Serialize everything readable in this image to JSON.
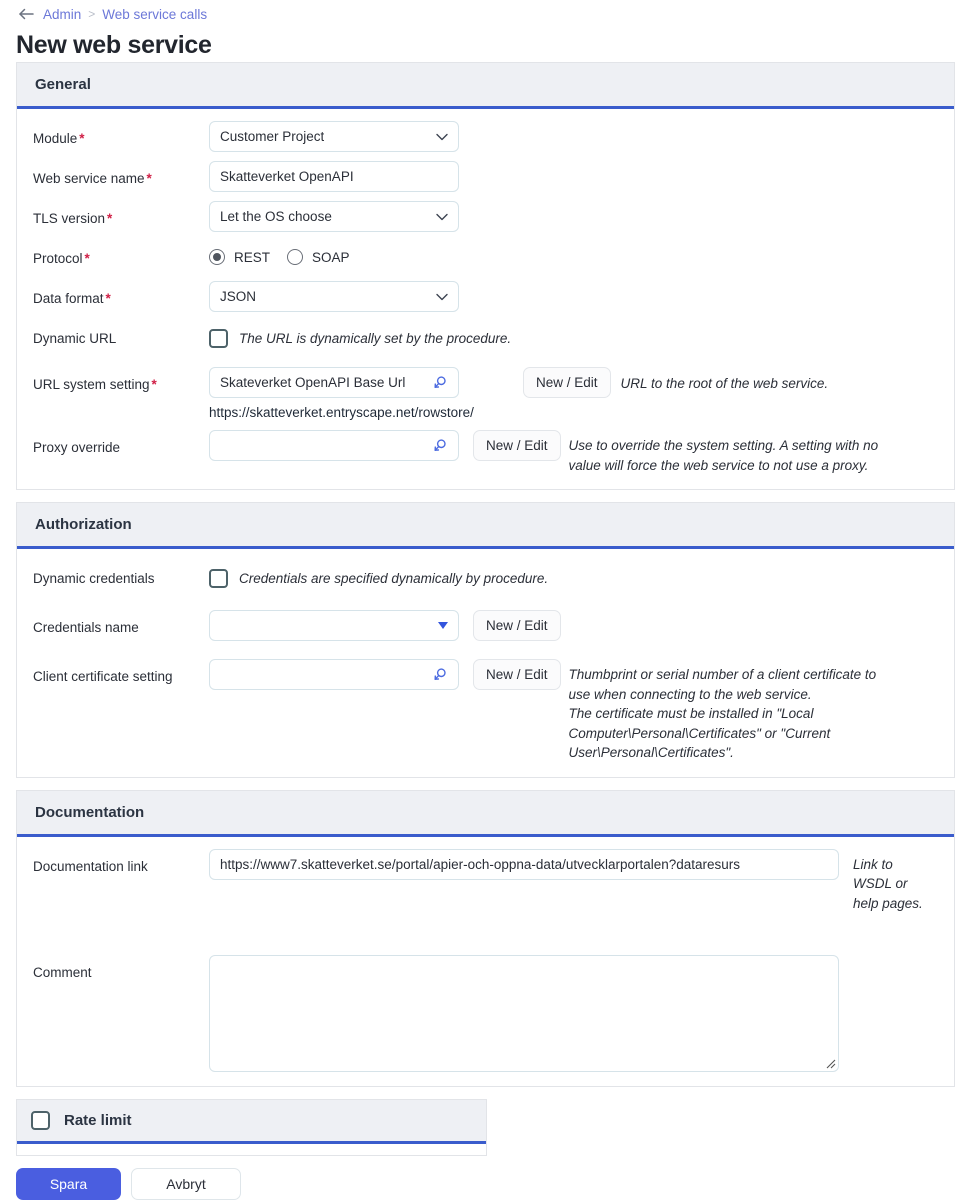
{
  "breadcrumb": {
    "back_icon": "back-arrow-icon",
    "items": [
      "Admin",
      "Web service calls"
    ],
    "separator": ">"
  },
  "page_title": "New web service",
  "colors": {
    "accent": "#3a5ccc",
    "primary_button": "#4a5ee0",
    "link": "#6c78d8",
    "required_marker": "#d01f46",
    "section_header_bg": "#eef0f4"
  },
  "sections": {
    "general": {
      "title": "General",
      "module": {
        "label": "Module",
        "required": "*",
        "value": "Customer Project"
      },
      "web_service_name": {
        "label": "Web service name",
        "required": "*",
        "value": "Skatteverket OpenAPI"
      },
      "tls_version": {
        "label": "TLS version",
        "required": "*",
        "value": "Let the OS choose"
      },
      "protocol": {
        "label": "Protocol",
        "required": "*",
        "options": [
          "REST",
          "SOAP"
        ],
        "selected": "REST"
      },
      "data_format": {
        "label": "Data format",
        "required": "*",
        "value": "JSON"
      },
      "dynamic_url": {
        "label": "Dynamic URL",
        "checkbox_label": "The URL is dynamically set by the procedure.",
        "checked": false
      },
      "url_system_setting": {
        "label": "URL system setting",
        "required": "*",
        "value": "Skateverket OpenAPI Base Url",
        "button": "New / Edit",
        "helper": "URL to the root of the web service.",
        "resolved_url": "https://skatteverket.entryscape.net/rowstore/"
      },
      "proxy_override": {
        "label": "Proxy override",
        "value": "",
        "button": "New / Edit",
        "helper_line1": "Use to override the system setting. A setting with no",
        "helper_line2": "value will force the web service to not use a proxy."
      }
    },
    "authorization": {
      "title": "Authorization",
      "dynamic_credentials": {
        "label": "Dynamic credentials",
        "checkbox_label": "Credentials are specified dynamically by procedure.",
        "checked": false
      },
      "credentials_name": {
        "label": "Credentials name",
        "value": "",
        "button": "New / Edit"
      },
      "client_certificate_setting": {
        "label": "Client certificate setting",
        "value": "",
        "button": "New / Edit",
        "helper_line1": "Thumbprint or serial number of a client certificate to",
        "helper_line2": "use when connecting to the web service.",
        "helper_line3": "The certificate must be installed in \"Local",
        "helper_line4": "Computer\\Personal\\Certificates\" or \"Current",
        "helper_line5": "User\\Personal\\Certificates\"."
      }
    },
    "documentation": {
      "title": "Documentation",
      "documentation_link": {
        "label": "Documentation link",
        "value": "https://www7.skatteverket.se/portal/apier-och-oppna-data/utvecklarportalen?dataresurs",
        "helper_line1": "Link to",
        "helper_line2": "WSDL or",
        "helper_line3": "help pages."
      },
      "comment": {
        "label": "Comment",
        "value": ""
      }
    },
    "rate_limit": {
      "title": "Rate limit",
      "checked": false
    }
  },
  "footer": {
    "save_label": "Spara",
    "cancel_label": "Avbryt"
  }
}
